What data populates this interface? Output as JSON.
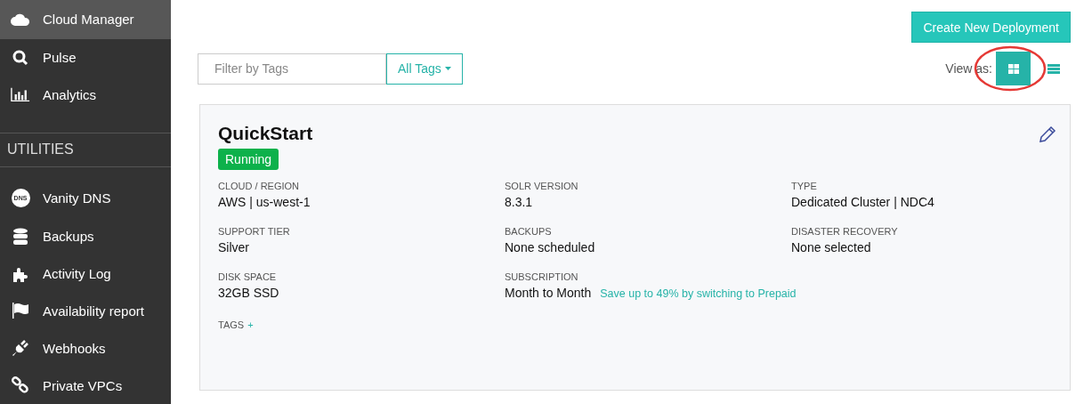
{
  "sidebar": {
    "items": [
      {
        "label": "Cloud Manager",
        "selected": true
      },
      {
        "label": "Pulse",
        "selected": false
      },
      {
        "label": "Analytics",
        "selected": false
      }
    ],
    "section_title": "UTILITIES",
    "utilities": [
      {
        "label": "Vanity DNS",
        "icon_text": "DNS",
        "selected": false
      },
      {
        "label": "Backups",
        "selected": false
      },
      {
        "label": "Activity Log",
        "selected": false
      },
      {
        "label": "Availability report",
        "selected": false
      },
      {
        "label": "Webhooks",
        "selected": false
      },
      {
        "label": "Private VPCs",
        "selected": false
      }
    ]
  },
  "create_button": "Create New Deployment",
  "filter": {
    "placeholder": "Filter by Tags",
    "dropdown": "All Tags"
  },
  "view": {
    "label": "View as:",
    "options": [
      {
        "kind": "grid",
        "selected": true
      },
      {
        "kind": "list",
        "selected": false
      }
    ],
    "highlighted": true
  },
  "deployment": {
    "name": "QuickStart",
    "status": "Running",
    "fields": [
      {
        "label": "CLOUD / REGION",
        "value": "AWS | us-west-1"
      },
      {
        "label": "SOLR VERSION",
        "value": "8.3.1"
      },
      {
        "label": "TYPE",
        "value": "Dedicated Cluster | NDC4"
      },
      {
        "label": "SUPPORT TIER",
        "value": "Silver"
      },
      {
        "label": "BACKUPS",
        "value": "None scheduled"
      },
      {
        "label": "DISASTER RECOVERY",
        "value": "None selected"
      },
      {
        "label": "DISK SPACE",
        "value": "32GB SSD"
      },
      {
        "label": "SUBSCRIPTION",
        "value": "Month to Month",
        "link": "Save up to 49% by switching to Prepaid"
      }
    ],
    "tags_label": "TAGS",
    "tags_add": "+"
  }
}
